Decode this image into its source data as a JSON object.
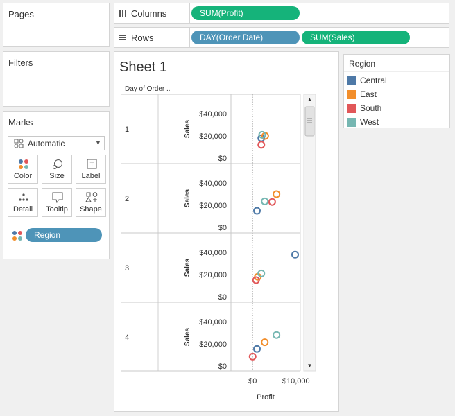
{
  "pages_card": {
    "title": "Pages"
  },
  "filters_card": {
    "title": "Filters"
  },
  "marks_card": {
    "title": "Marks",
    "mark_type": "Automatic",
    "buttons": [
      {
        "label": "Color",
        "icon": "color-icon"
      },
      {
        "label": "Size",
        "icon": "size-icon"
      },
      {
        "label": "Label",
        "icon": "label-icon"
      },
      {
        "label": "Detail",
        "icon": "detail-icon"
      },
      {
        "label": "Tooltip",
        "icon": "tooltip-icon"
      },
      {
        "label": "Shape",
        "icon": "shape-icon"
      }
    ],
    "color_field": "Region"
  },
  "columns_shelf": {
    "label": "Columns",
    "pills": [
      "SUM(Profit)"
    ]
  },
  "rows_shelf": {
    "label": "Rows",
    "pills": [
      "DAY(Order Date)",
      "SUM(Sales)"
    ]
  },
  "sheet": {
    "title": "Sheet 1",
    "row_header": "Day of Order .."
  },
  "legend": {
    "title": "Region",
    "items": [
      {
        "name": "Central",
        "color": "#4e79a7"
      },
      {
        "name": "East",
        "color": "#f28e2b"
      },
      {
        "name": "South",
        "color": "#e15759"
      },
      {
        "name": "West",
        "color": "#76b7b2"
      }
    ]
  },
  "chart_data": {
    "type": "scatter",
    "xlabel": "Profit",
    "ylabel": "Sales",
    "x_ticks": [
      "$0",
      "$10,000"
    ],
    "x_tick_values": [
      0,
      10000
    ],
    "xlim": [
      -5000,
      11000
    ],
    "y_ticks": [
      "$0",
      "$20,000",
      "$40,000"
    ],
    "y_tick_values": [
      0,
      20000,
      40000
    ],
    "ylim": [
      0,
      45000
    ],
    "panes": [
      {
        "day": "1",
        "points": [
          {
            "region": "Central",
            "x": 2000,
            "y": 18000
          },
          {
            "region": "East",
            "x": 2900,
            "y": 20000
          },
          {
            "region": "South",
            "x": 2000,
            "y": 12000
          },
          {
            "region": "West",
            "x": 2200,
            "y": 21000
          }
        ]
      },
      {
        "day": "2",
        "points": [
          {
            "region": "Central",
            "x": 1000,
            "y": 15000
          },
          {
            "region": "East",
            "x": 5500,
            "y": 30000
          },
          {
            "region": "South",
            "x": 4500,
            "y": 23000
          },
          {
            "region": "West",
            "x": 2800,
            "y": 23500
          }
        ]
      },
      {
        "day": "3",
        "points": [
          {
            "region": "Central",
            "x": 9800,
            "y": 38000
          },
          {
            "region": "East",
            "x": 1200,
            "y": 18000
          },
          {
            "region": "South",
            "x": 800,
            "y": 15000
          },
          {
            "region": "West",
            "x": 2000,
            "y": 21000
          }
        ]
      },
      {
        "day": "4",
        "points": [
          {
            "region": "Central",
            "x": 1000,
            "y": 15500
          },
          {
            "region": "East",
            "x": 2800,
            "y": 21500
          },
          {
            "region": "South",
            "x": 0,
            "y": 8500
          },
          {
            "region": "West",
            "x": 5500,
            "y": 28000
          }
        ]
      }
    ]
  }
}
